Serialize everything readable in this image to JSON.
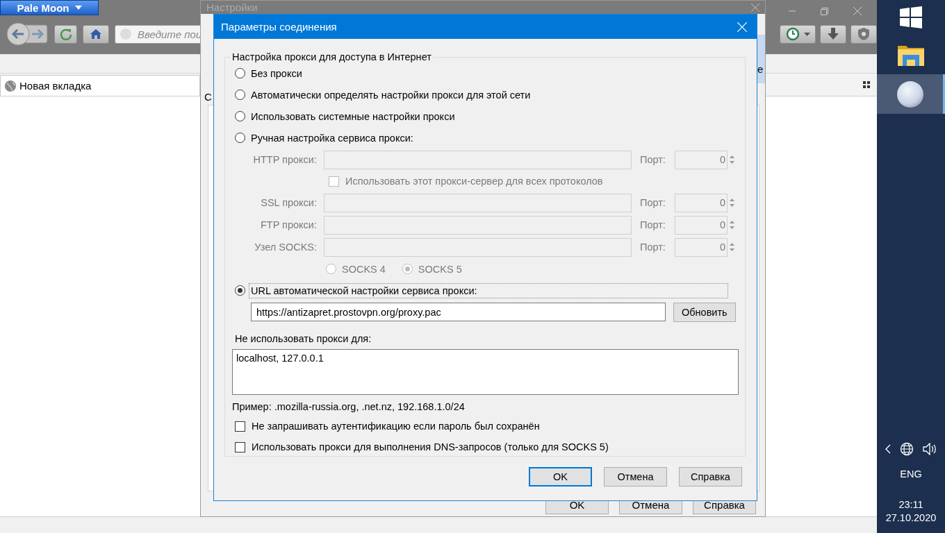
{
  "browser": {
    "menu_button": "Pale Moon",
    "address_placeholder": "Введите пои",
    "tab": {
      "label": "Новая вкладка",
      "selected": true
    }
  },
  "settings_window": {
    "title": "Настройки",
    "cut_left": "С",
    "cut_right": "е",
    "buttons": [
      "OK",
      "Отмена",
      "Справка"
    ]
  },
  "dialog": {
    "title": "Параметры соединения",
    "group_title": "Настройка прокси для доступа в Интернет",
    "proxy_modes": [
      {
        "kind": "plain",
        "label": "Без прокси",
        "selected": false
      },
      {
        "kind": "plain",
        "label": "Автоматически определять настройки прокси для этой сети",
        "selected": false
      },
      {
        "kind": "plain",
        "label": "Использовать системные настройки прокси",
        "selected": false
      },
      {
        "kind": "manual",
        "label": "Ручная настройка сервиса прокси:",
        "selected": false
      },
      {
        "kind": "pac",
        "label": "URL автоматической настройки сервиса прокси:",
        "selected": true
      }
    ],
    "manual": {
      "disabled": true,
      "rows": [
        {
          "kind": "proxy",
          "label": "HTTP прокси:",
          "port_label": "Порт:",
          "port": "0"
        },
        {
          "kind": "share",
          "label": "Использовать этот прокси-сервер для всех протоколов",
          "checked": false
        },
        {
          "kind": "proxy",
          "label": "SSL прокси:",
          "port_label": "Порт:",
          "port": "0"
        },
        {
          "kind": "proxy",
          "label": "FTP прокси:",
          "port_label": "Порт:",
          "port": "0"
        },
        {
          "kind": "proxy",
          "label": "Узел SOCKS:",
          "port_label": "Порт:",
          "port": "0"
        }
      ],
      "socks_versions": [
        {
          "label": "SOCKS 4",
          "selected": false
        },
        {
          "label": "SOCKS 5",
          "selected": true
        }
      ]
    },
    "pac": {
      "value": "https://antizapret.prostovpn.org/proxy.pac",
      "button": "Обновить"
    },
    "no_proxy": {
      "label": "Не использовать прокси для:",
      "value": "localhost, 127.0.0.1",
      "example": "Пример: .mozilla-russia.org, .net.nz, 192.168.1.0/24"
    },
    "options": [
      {
        "label": "Не запрашивать аутентификацию если пароль был сохранён",
        "checked": false
      },
      {
        "label": "Использовать прокси для выполнения DNS-запросов (только для SOCKS 5)",
        "checked": false
      }
    ],
    "buttons": [
      {
        "label": "OK",
        "default": true
      },
      {
        "label": "Отмена",
        "default": false
      },
      {
        "label": "Справка",
        "default": false
      }
    ]
  },
  "taskbar": {
    "apps": [
      {
        "kind": "explorer",
        "active": false
      },
      {
        "kind": "browser",
        "active": true
      }
    ],
    "language": "ENG",
    "time": "23:11",
    "date": "27.10.2020"
  }
}
